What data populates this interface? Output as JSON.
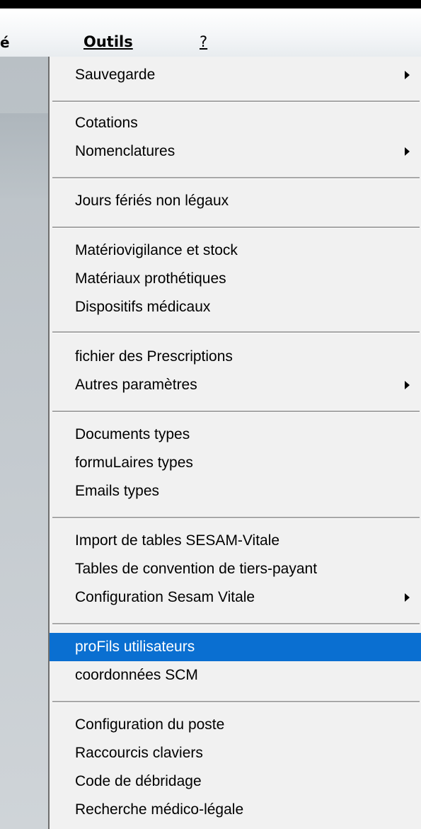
{
  "menubar": {
    "left_fragment": "é",
    "outils_label": "Outils",
    "help_label": "?"
  },
  "menu": {
    "items": [
      {
        "label": "Sauvegarde",
        "submenu": true
      },
      {
        "label": "Cotations",
        "submenu": false
      },
      {
        "label": "Nomenclatures",
        "submenu": true
      },
      {
        "label": "Jours fériés non légaux",
        "submenu": false
      },
      {
        "label": "Matériovigilance et stock",
        "submenu": false
      },
      {
        "label": "Matériaux prothétiques",
        "submenu": false
      },
      {
        "label": "Dispositifs médicaux",
        "submenu": false
      },
      {
        "label": "fichier des Prescriptions",
        "submenu": false
      },
      {
        "label": "Autres paramètres",
        "submenu": true
      },
      {
        "label": "Documents types",
        "submenu": false
      },
      {
        "label": "formuLaires types",
        "submenu": false
      },
      {
        "label": "Emails types",
        "submenu": false
      },
      {
        "label": "Import de tables SESAM-Vitale",
        "submenu": false
      },
      {
        "label": "Tables de convention de tiers-payant",
        "submenu": false
      },
      {
        "label": "Configuration Sesam Vitale",
        "submenu": true
      },
      {
        "label": "proFils utilisateurs",
        "submenu": false,
        "selected": true
      },
      {
        "label": "coordonnées SCM",
        "submenu": false
      },
      {
        "label": "Configuration du poste",
        "submenu": false
      },
      {
        "label": "Raccourcis claviers",
        "submenu": false
      },
      {
        "label": "Code de débridage",
        "submenu": false
      },
      {
        "label": "Recherche médico-légale",
        "submenu": false
      }
    ]
  },
  "colors": {
    "selection": "#0a6fd1",
    "menu_background": "#f1f1f1"
  }
}
